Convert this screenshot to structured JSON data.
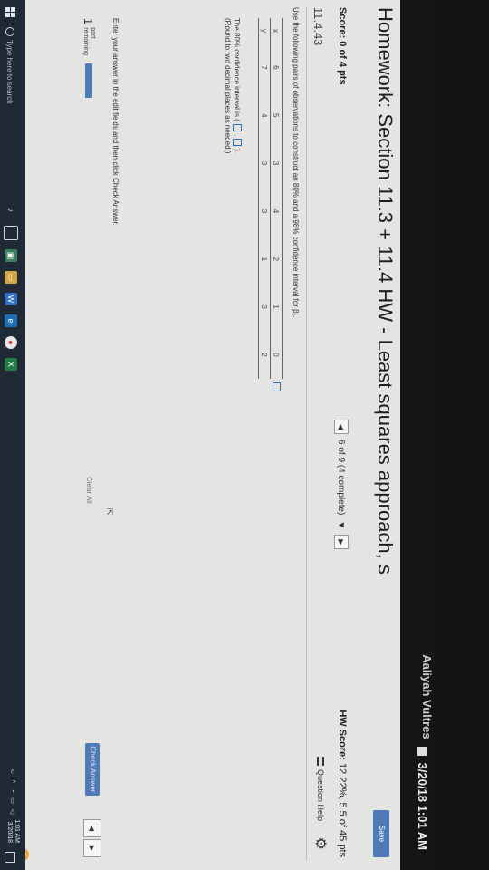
{
  "monitor": {
    "user_name": "Aaliyah Vultres",
    "top_datetime": "3/20/18 1:01 AM"
  },
  "page": {
    "title": "Homework: Section 11.3 + 11.4 HW - Least squares approach, s",
    "save_label": "Save",
    "score_label": "Score: 0 of 4 pts",
    "progress": "6 of 9 (4 complete)",
    "hw_score_bold": "HW Score:",
    "hw_score_value": "12.22%, 5.5 of 45 pts",
    "question_number": "11.4.43",
    "question_help_label": "Question Help",
    "instruction": "Use the following pairs of observations to construct an 80% and a 98% confidence interval for β₁.",
    "table": {
      "x_label": "x",
      "y_label": "y",
      "x_values": [
        "6",
        "5",
        "3",
        "4",
        "2",
        "1",
        "0"
      ],
      "y_values": [
        "7",
        "4",
        "3",
        "3",
        "1",
        "3",
        "2"
      ]
    },
    "ci_label": "The 80% confidence interval is (",
    "ci_sep": ",",
    "ci_close": ").",
    "round_note": "(Round to two decimal places as needed.)",
    "enter_instruction": "Enter your answer in the edit fields and then click Check Answer.",
    "parts_count": "1",
    "parts_label_1": "part",
    "parts_label_2": "remaining",
    "clear_all_label": "Clear All",
    "check_answer_label": "Check Answer",
    "help_glyph": "?"
  },
  "taskbar": {
    "search_placeholder": "Type here to search",
    "clock_time": "1:01 AM",
    "clock_date": "3/20/18"
  },
  "colors": {
    "accent_blue": "#4f7ab8",
    "taskbar_bg": "#1f2a36",
    "help_orange": "#f0a833"
  }
}
